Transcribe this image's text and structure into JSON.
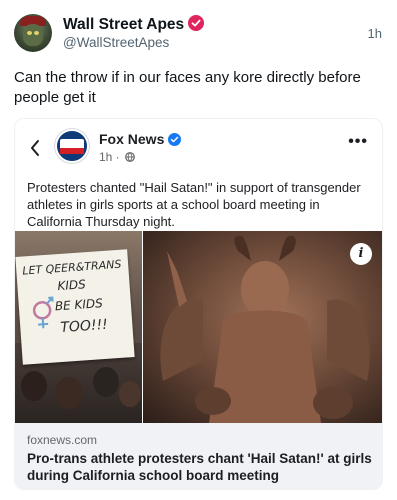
{
  "tweet": {
    "display_name": "Wall Street Apes",
    "handle": "@WallStreetApes",
    "time": "1h",
    "text": "Can the throw if in our faces any kore directly before people get it"
  },
  "embed": {
    "back_icon": "chevron-left-icon",
    "page_name": "Fox News",
    "meta": "1h ·",
    "post_text": "Protesters chanted \"Hail Satan!\" in support of transgender athletes in girls sports at a school board meeting in California Thursday night.",
    "sign_lines": [
      "LET QEER&TRANS",
      "KIDS",
      "BE KIDS",
      "TOO!!!"
    ],
    "info_label": "i",
    "link_domain": "foxnews.com",
    "link_title": "Pro-trans athlete protesters chant 'Hail Satan!' at girls during California school board meeting"
  },
  "colors": {
    "verified_blue": "#1d9bf0",
    "fox_blue": "#0f3a7a",
    "fox_red": "#d32027",
    "verified_pink": "#e0245e"
  }
}
